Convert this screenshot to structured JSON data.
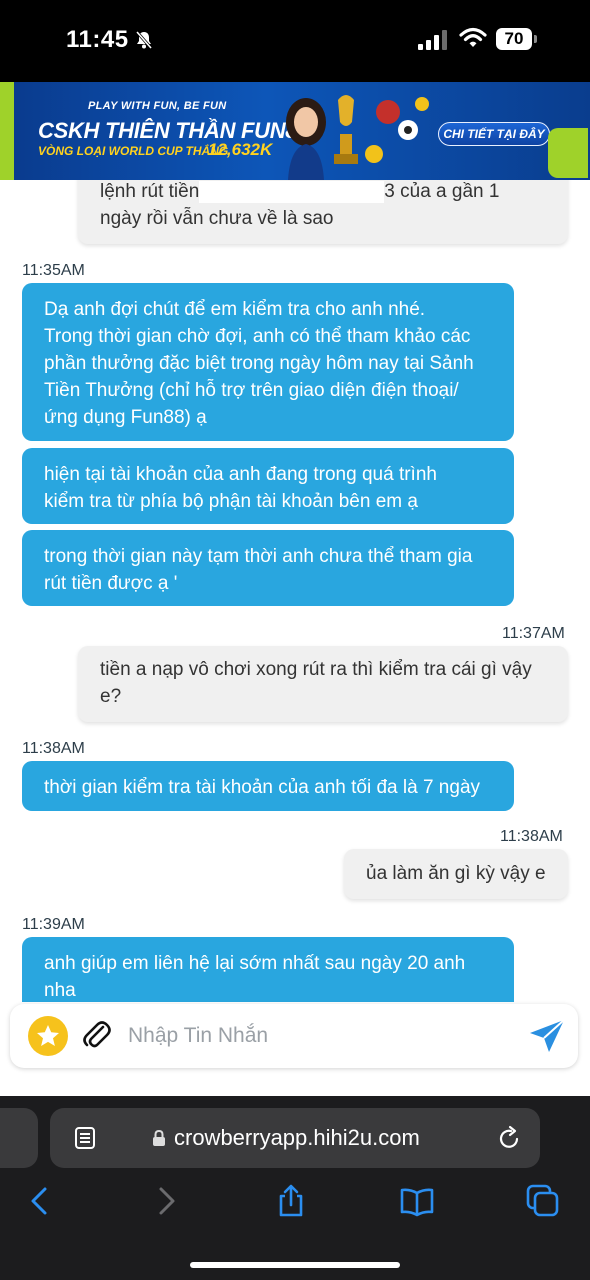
{
  "status_bar": {
    "time": "11:45",
    "battery": "70",
    "icons": [
      "bell-slash-icon",
      "signal-icon",
      "wifi-icon",
      "battery-icon"
    ]
  },
  "banner": {
    "tagline": "PLAY WITH FUN, BE FUN",
    "title": "CSKH THIÊN THẦN FUN88",
    "subtitle": "VÒNG LOẠI WORLD CUP THẮNG",
    "amount": "12,632K",
    "cta": "CHI TIẾT TẠI ĐÂY",
    "colors": {
      "background": "#0d56b8",
      "accent": "#ffd21f",
      "logo": "#9fd22a"
    }
  },
  "chat": {
    "colors": {
      "agent_bubble": "#29a6df",
      "user_bubble": "#f0f0f0"
    },
    "messages": [
      {
        "from": "user",
        "lines": [
          "lệnh rút tiền",
          "3 của a gần 1",
          "ngày rồi vẫn chưa về là sao"
        ]
      },
      {
        "from": "agent",
        "timestamp": "11:35AM",
        "lines": [
          "Dạ anh đợi chút để em kiểm tra cho anh nhé.",
          "Trong thời gian chờ đợi, anh có thể tham khảo các",
          "phần thưởng đặc biệt trong ngày hôm nay tại Sảnh",
          "Tiền Thưởng (chỉ hỗ trợ trên giao diện điện thoại/",
          "ứng dụng Fun88) ạ"
        ]
      },
      {
        "from": "agent",
        "lines": [
          "hiện tại tài khoản của anh đang trong quá trình",
          "kiểm tra từ phía bộ phận tài khoản bên em ạ"
        ]
      },
      {
        "from": "agent",
        "lines": [
          "trong thời gian này tạm thời anh chưa thể tham gia",
          "rút tiền được ạ '"
        ]
      },
      {
        "from": "user",
        "timestamp": "11:37AM",
        "lines": [
          "tiền a nạp vô chơi xong rút ra thì kiểm tra cái gì vậy",
          "e?"
        ]
      },
      {
        "from": "agent",
        "timestamp": "11:38AM",
        "lines": [
          "thời gian kiểm tra tài khoản của anh tối đa là 7 ngày"
        ]
      },
      {
        "from": "user",
        "timestamp": "11:38AM",
        "lines": [
          "ủa làm ăn gì kỳ vậy e"
        ]
      },
      {
        "from": "agent",
        "timestamp": "11:39AM",
        "lines": [
          "anh giúp em liên hệ lại sớm nhất sau ngày 20 anh",
          "nha"
        ]
      }
    ]
  },
  "input": {
    "placeholder": "Nhập Tin Nhắn",
    "icons": [
      "star-icon",
      "paperclip-icon",
      "send-icon"
    ]
  },
  "browser": {
    "url": "crowberryapp.hihi2u.com",
    "toolbar_icons": [
      "back-icon",
      "forward-icon",
      "share-icon",
      "bookmarks-icon",
      "tabs-icon"
    ]
  }
}
